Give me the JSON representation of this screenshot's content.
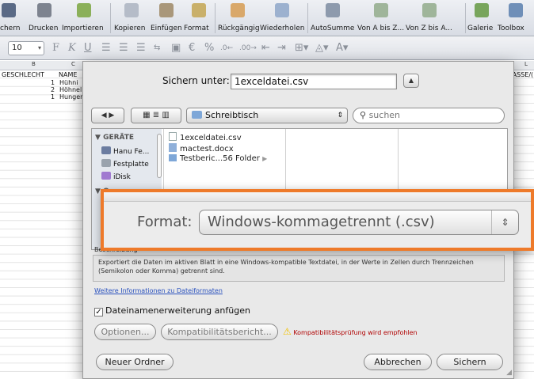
{
  "toolbar": {
    "items": [
      {
        "label": "chern",
        "icon": "save-icon"
      },
      {
        "label": "Drucken",
        "icon": "print-icon"
      },
      {
        "label": "Importieren",
        "icon": "import-icon"
      },
      {
        "label": "Kopieren",
        "icon": "copy-icon"
      },
      {
        "label": "Einfügen",
        "icon": "paste-icon"
      },
      {
        "label": "Format",
        "icon": "format-brush-icon"
      },
      {
        "label": "Rückgängig",
        "icon": "undo-icon"
      },
      {
        "label": "Wiederholen",
        "icon": "redo-icon"
      },
      {
        "label": "AutoSumme",
        "icon": "sum-icon"
      },
      {
        "label": "Von A bis Z...",
        "icon": "sort-az-icon"
      },
      {
        "label": "Von Z bis A...",
        "icon": "sort-za-icon"
      },
      {
        "label": "Galerie",
        "icon": "gallery-icon"
      },
      {
        "label": "Toolbox",
        "icon": "toolbox-icon"
      }
    ]
  },
  "format_bar": {
    "font_size": "10",
    "bold": "F",
    "italic": "K",
    "underline": "U"
  },
  "sheet": {
    "columns": [
      "B",
      "C",
      "L"
    ],
    "headers": [
      "GESCHLECHT",
      "NAME",
      "LASSE/("
    ],
    "rows": [
      {
        "id": "1",
        "name": "Hühni"
      },
      {
        "id": "2",
        "name": "Höhnel"
      },
      {
        "id": "1",
        "name": "Hunger"
      }
    ]
  },
  "dialog": {
    "save_as_label": "Sichern unter:",
    "filename": "1exceldatei.csv",
    "location": "Schreibtisch",
    "search_placeholder": "suchen",
    "sidebar": {
      "devices_heading": "GERÄTE",
      "devices": [
        "Hanu Fe...",
        "Festplatte",
        "iDisk"
      ],
      "places_heading_fragment": "O"
    },
    "files": [
      {
        "name": "1exceldatei.csv",
        "icon": "csv-file-icon"
      },
      {
        "name": "mactest.docx",
        "icon": "docx-file-icon"
      },
      {
        "name": "Testberic...56 Folder",
        "icon": "folder-icon"
      }
    ],
    "format_label": "Format:",
    "format_value": "Windows-kommagetrennt (.csv)",
    "description_heading": "Beschreibung",
    "description_text": "Exportiert die Daten im aktiven Blatt in eine Windows-kompatible Textdatei, in der Werte in Zellen durch Trennzeichen (Semikolon oder Komma) getrennt sind.",
    "more_info_link": "Weitere Informationen zu Dateiformaten",
    "extension_checkbox_label": "Dateinamenerweiterung anfügen",
    "extension_checked": true,
    "options_button": "Optionen...",
    "compat_button": "Kompatibilitätsbericht...",
    "compat_warning": "Kompatibilitätsprüfung wird empfohlen",
    "new_folder_button": "Neuer Ordner",
    "cancel_button": "Abbrechen",
    "save_button": "Sichern"
  },
  "colors": {
    "highlight": "#ee7a2a",
    "link": "#2a52be",
    "warning": "#f2c200"
  }
}
